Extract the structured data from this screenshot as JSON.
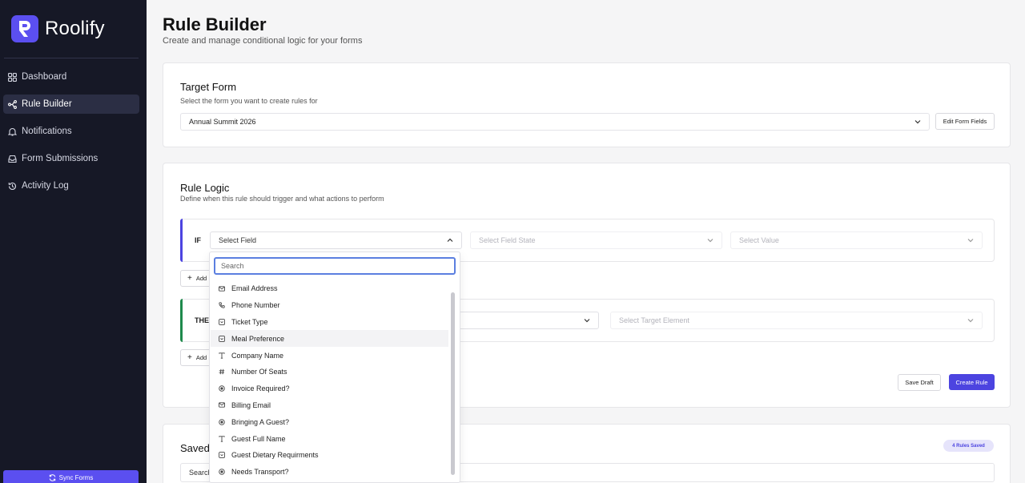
{
  "app": {
    "name": "Roolify"
  },
  "sidebar": {
    "items": [
      {
        "label": "Dashboard",
        "icon": "grid-icon",
        "active": false
      },
      {
        "label": "Rule Builder",
        "icon": "branch-icon",
        "active": true
      },
      {
        "label": "Notifications",
        "icon": "bell-icon",
        "active": false
      },
      {
        "label": "Form Submissions",
        "icon": "inbox-icon",
        "active": false
      },
      {
        "label": "Activity Log",
        "icon": "history-icon",
        "active": false
      }
    ],
    "sync_label": "Sync Forms"
  },
  "header": {
    "title": "Rule Builder",
    "subtitle": "Create and manage conditional logic for your forms"
  },
  "target_form": {
    "title": "Target Form",
    "description": "Select the form you want to create rules for",
    "selected": "Annual Summit 2026",
    "edit_label": "Edit Form Fields"
  },
  "rule_logic": {
    "title": "Rule Logic",
    "description": "Define when this rule should trigger and what actions to perform",
    "if_label": "IF",
    "field_placeholder": "Select Field",
    "state_placeholder": "Select Field State",
    "value_placeholder": "Select Value",
    "then_label": "THE",
    "target_placeholder": "Select Target Element",
    "add_label": "Add",
    "save_draft": "Save Draft",
    "create_rule": "Create Rule"
  },
  "saved": {
    "title": "Saved",
    "badge": "4 Rules Saved",
    "search_label": "Search"
  },
  "dropdown": {
    "search_placeholder": "Search",
    "items": [
      {
        "label": "Email Address",
        "icon": "mail-icon"
      },
      {
        "label": "Phone Number",
        "icon": "phone-icon"
      },
      {
        "label": "Ticket Type",
        "icon": "select-icon"
      },
      {
        "label": "Meal Preference",
        "icon": "select-icon",
        "highlighted": true
      },
      {
        "label": "Company Name",
        "icon": "text-icon"
      },
      {
        "label": "Number Of Seats",
        "icon": "hash-icon"
      },
      {
        "label": "Invoice Required?",
        "icon": "radio-icon"
      },
      {
        "label": "Billing Email",
        "icon": "mail-icon"
      },
      {
        "label": "Bringing A Guest?",
        "icon": "radio-icon"
      },
      {
        "label": "Guest Full Name",
        "icon": "text-icon"
      },
      {
        "label": "Guest Dietary Requirments",
        "icon": "select-icon"
      },
      {
        "label": "Needs Transport?",
        "icon": "radio-icon"
      }
    ]
  },
  "colors": {
    "sidebar_bg": "#161826",
    "brand": "#5b4ff0",
    "primary_button": "#4c44e0",
    "if_accent": "#4c44e0",
    "then_accent": "#1f8a4c"
  }
}
